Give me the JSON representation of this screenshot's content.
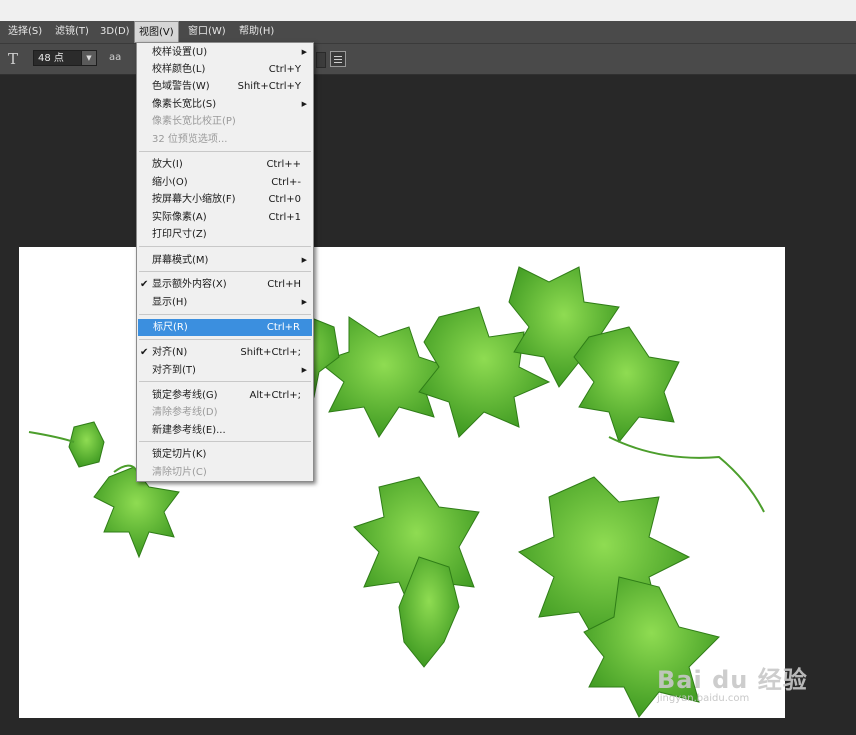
{
  "menubar": {
    "items": [
      {
        "label": "选择(S)"
      },
      {
        "label": "滤镜(T)"
      },
      {
        "label": "3D(D)"
      },
      {
        "label": "视图(V)"
      },
      {
        "label": "窗口(W)"
      },
      {
        "label": "帮助(H)"
      }
    ]
  },
  "options_bar": {
    "font_size": "48 点",
    "aa_icon": "aa"
  },
  "view_menu": {
    "items": [
      {
        "label": "校样设置(U)",
        "shortcut": "",
        "submenu": true
      },
      {
        "label": "校样颜色(L)",
        "shortcut": "Ctrl+Y"
      },
      {
        "label": "色域警告(W)",
        "shortcut": "Shift+Ctrl+Y"
      },
      {
        "label": "像素长宽比(S)",
        "shortcut": "",
        "submenu": true
      },
      {
        "label": "像素长宽比校正(P)",
        "shortcut": "",
        "disabled": true
      },
      {
        "label": "32 位预览选项...",
        "shortcut": "",
        "disabled": true
      },
      {
        "label": "放大(I)",
        "shortcut": "Ctrl++"
      },
      {
        "label": "缩小(O)",
        "shortcut": "Ctrl+-"
      },
      {
        "label": "按屏幕大小缩放(F)",
        "shortcut": "Ctrl+0"
      },
      {
        "label": "实际像素(A)",
        "shortcut": "Ctrl+1"
      },
      {
        "label": "打印尺寸(Z)",
        "shortcut": ""
      },
      {
        "label": "屏幕模式(M)",
        "shortcut": "",
        "submenu": true
      },
      {
        "label": "显示额外内容(X)",
        "shortcut": "Ctrl+H",
        "checked": true
      },
      {
        "label": "显示(H)",
        "shortcut": "",
        "submenu": true
      },
      {
        "label": "标尺(R)",
        "shortcut": "Ctrl+R",
        "highlighted": true
      },
      {
        "label": "对齐(N)",
        "shortcut": "Shift+Ctrl+;",
        "checked": true
      },
      {
        "label": "对齐到(T)",
        "shortcut": "",
        "submenu": true
      },
      {
        "label": "锁定参考线(G)",
        "shortcut": "Alt+Ctrl+;"
      },
      {
        "label": "清除参考线(D)",
        "shortcut": "",
        "disabled": true
      },
      {
        "label": "新建参考线(E)...",
        "shortcut": ""
      },
      {
        "label": "锁定切片(K)",
        "shortcut": ""
      },
      {
        "label": "清除切片(C)",
        "shortcut": "",
        "disabled": true
      }
    ],
    "check_mark": "✔",
    "submenu_arrow": "▶"
  },
  "watermark": {
    "brand": "Bai du 经验",
    "url": "jingyan.baidu.com"
  },
  "colors": {
    "menu_highlight": "#3b8fdf",
    "workspace": "#282828",
    "leaf_light": "#7ed24a",
    "leaf_dark": "#3f9a22"
  }
}
